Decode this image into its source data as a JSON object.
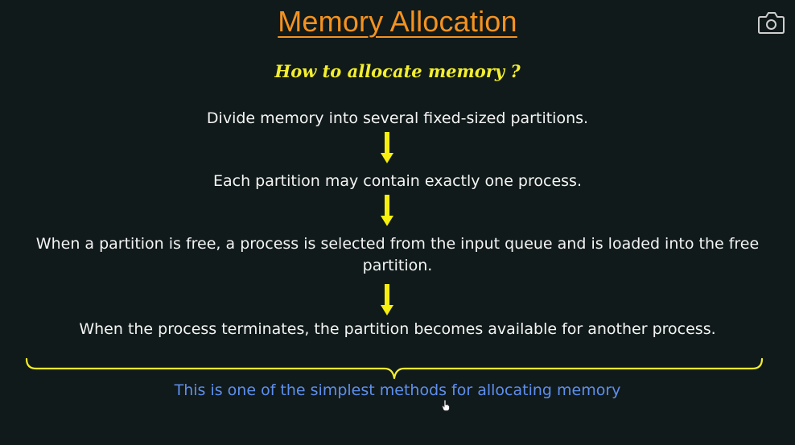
{
  "slide": {
    "title": "Memory Allocation",
    "subtitle": "How to allocate memory ?",
    "steps": [
      "Divide memory into several fixed-sized partitions.",
      "Each partition may contain exactly one process.",
      "When a partition is free, a process is selected from the input queue and is loaded into the free partition.",
      "When the process terminates, the partition becomes available for another process."
    ],
    "note": "This is one of the simplest methods for allocating memory"
  },
  "colors": {
    "background": "#111a1a",
    "title": "#f5921f",
    "subtitle": "#f3ee2e",
    "arrow": "#f7ef10",
    "brace": "#f3ee2e",
    "note": "#5e8fee"
  },
  "icons": {
    "camera": "camera-icon",
    "arrow": "arrow-down-icon",
    "brace": "curly-brace-icon",
    "cursor": "mouse-cursor-icon"
  }
}
